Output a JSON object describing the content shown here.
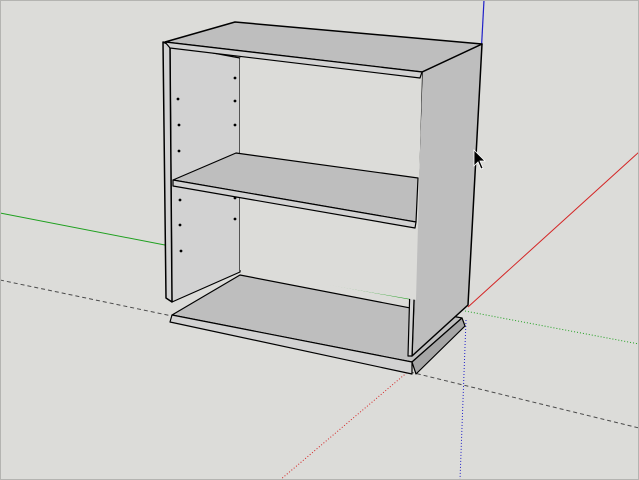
{
  "viewport": {
    "background_color": "#dcdcd9",
    "view": "perspective"
  },
  "axes": {
    "red_color": "#d42525",
    "green_color": "#1fa01f",
    "blue_color": "#2020c8",
    "inferred_color": "#4a4a4a"
  },
  "model": {
    "object": "bookshelf",
    "shelf_count": 1,
    "side_panel_holes_per_side": 6,
    "face_light_color": "#d2d2d2",
    "face_mid_color": "#bebebe",
    "face_dark_color": "#a6a6a6",
    "edge_color": "#000000"
  },
  "cursor": {
    "icon": "arrow-cursor-icon"
  }
}
